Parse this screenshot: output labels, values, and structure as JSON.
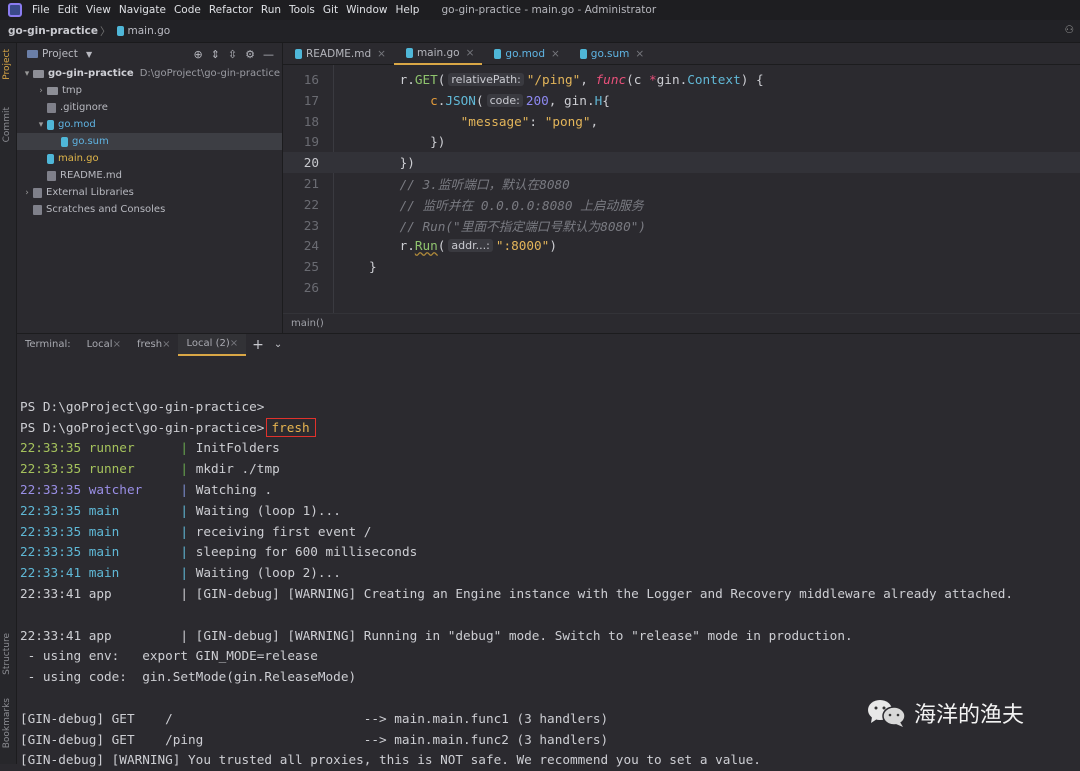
{
  "menu": [
    "File",
    "Edit",
    "View",
    "Navigate",
    "Code",
    "Refactor",
    "Run",
    "Tools",
    "Git",
    "Window",
    "Help"
  ],
  "window_title": "go-gin-practice - main.go - Administrator",
  "breadcrumb": {
    "project": "go-gin-practice",
    "file": "main.go"
  },
  "left_strip": {
    "project": "Project",
    "commit": "Commit",
    "structure": "Structure",
    "bookmarks": "Bookmarks"
  },
  "project_panel": {
    "title": "Project",
    "tree": [
      {
        "label": "go-gin-practice",
        "extra": "D:\\goProject\\go-gin-practice",
        "indent": 0,
        "arrow": "▾",
        "icon": "folder",
        "bold": true,
        "color": "#cfd0d6"
      },
      {
        "label": "tmp",
        "indent": 1,
        "arrow": "›",
        "icon": "folder",
        "color": "#b8b9c0"
      },
      {
        "label": ".gitignore",
        "indent": 1,
        "arrow": "",
        "icon": "file",
        "color": "#b8b9c0"
      },
      {
        "label": "go.mod",
        "indent": 1,
        "arrow": "▾",
        "icon": "go",
        "color": "#5fb4e3"
      },
      {
        "label": "go.sum",
        "indent": 2,
        "arrow": "",
        "icon": "go",
        "color": "#5fb4e3",
        "selected": true
      },
      {
        "label": "main.go",
        "indent": 1,
        "arrow": "",
        "icon": "go",
        "color": "#e0b64a"
      },
      {
        "label": "README.md",
        "indent": 1,
        "arrow": "",
        "icon": "md",
        "color": "#b8b9c0"
      },
      {
        "label": "External Libraries",
        "indent": 0,
        "arrow": "›",
        "icon": "lib",
        "color": "#b8b9c0"
      },
      {
        "label": "Scratches and Consoles",
        "indent": 0,
        "arrow": "",
        "icon": "scratch",
        "color": "#b8b9c0"
      }
    ]
  },
  "editor_tabs": [
    {
      "label": "README.md",
      "color": "#b5b6bd",
      "active": false
    },
    {
      "label": "main.go",
      "color": "#b5b6bd",
      "active": true
    },
    {
      "label": "go.mod",
      "color": "#5fb4e3",
      "active": false
    },
    {
      "label": "go.sum",
      "color": "#5fb4e3",
      "active": false
    }
  ],
  "code_lines": [
    {
      "n": "16",
      "indent": 4,
      "segs": [
        [
          "r",
          "#cdced3"
        ],
        [
          ".",
          "#cdced3"
        ],
        [
          "GET",
          "#8fc46e"
        ],
        [
          "(",
          "#cdced3"
        ],
        {
          "hint": "relativePath:"
        },
        [
          "\"/ping\"",
          "#e3b55a"
        ],
        [
          ", ",
          "#cdced3"
        ],
        [
          "func",
          "#e8507a",
          "i"
        ],
        [
          "(c ",
          "#cdced3"
        ],
        [
          "*",
          "#e8507a"
        ],
        [
          "gin.",
          "#cdced3"
        ],
        [
          "Context",
          "#61b8d6"
        ],
        [
          ") {",
          "#cdced3"
        ]
      ]
    },
    {
      "n": "17",
      "indent": 8,
      "segs": [
        [
          "c",
          "#e39b3a"
        ],
        [
          ".",
          "#cdced3"
        ],
        [
          "JSON",
          "#61b8d6"
        ],
        [
          "(",
          "#cdced3"
        ],
        {
          "hint": "code:"
        },
        [
          "200",
          "#8d88f0"
        ],
        [
          ", gin.",
          "#cdced3"
        ],
        [
          "H",
          "#61b8d6"
        ],
        [
          "{",
          "#cdced3"
        ]
      ]
    },
    {
      "n": "18",
      "indent": 12,
      "segs": [
        [
          "\"message\"",
          "#e3b55a"
        ],
        [
          ": ",
          "#cdced3"
        ],
        [
          "\"pong\"",
          "#e3b55a"
        ],
        [
          ",",
          "#cdced3"
        ]
      ]
    },
    {
      "n": "19",
      "indent": 8,
      "segs": [
        [
          "})",
          "#cdced3"
        ]
      ]
    },
    {
      "n": "20",
      "indent": 4,
      "segs": [
        [
          "})",
          "#cdced3"
        ]
      ],
      "current": true
    },
    {
      "n": "21",
      "indent": 4,
      "segs": [
        [
          "// 3.监听端口，默认在8080",
          "#7a7b82",
          "i"
        ]
      ]
    },
    {
      "n": "22",
      "indent": 4,
      "segs": [
        [
          "// 监听并在 0.0.0.0:8080 上启动服务",
          "#7a7b82",
          "i"
        ]
      ]
    },
    {
      "n": "23",
      "indent": 4,
      "segs": [
        [
          "// Run(\"里面不指定端口号默认为8080\")",
          "#7a7b82",
          "i"
        ]
      ]
    },
    {
      "n": "24",
      "indent": 4,
      "segs": [
        [
          "r.",
          "#cdced3"
        ],
        [
          "Run",
          "#8fc46e",
          "u"
        ],
        [
          "(",
          "#cdced3"
        ],
        {
          "hint": "addr...:"
        },
        [
          "\":8000\"",
          "#e3b55a"
        ],
        [
          ")",
          "#cdced3"
        ]
      ]
    },
    {
      "n": "25",
      "indent": 0,
      "segs": [
        [
          "}",
          "#cdced3"
        ]
      ]
    },
    {
      "n": "26",
      "indent": 0,
      "segs": []
    }
  ],
  "editor_breadcrumb": "main()",
  "terminal": {
    "label": "Terminal:",
    "tabs": [
      {
        "label": "Local",
        "active": false
      },
      {
        "label": "fresh",
        "active": false
      },
      {
        "label": "Local (2)",
        "active": true
      }
    ],
    "lines": [
      [],
      [
        [
          "PS D:\\goProject\\go-gin-practice>",
          "#cdced3"
        ]
      ],
      [
        [
          "PS D:\\goProject\\go-gin-practice>",
          "#cdced3"
        ],
        {
          "box": "fresh",
          "c": "#e6b450"
        }
      ],
      [
        [
          "22:33:35 runner      ",
          "#a5c25c"
        ],
        [
          "| ",
          "#6aa84f"
        ],
        [
          "InitFolders",
          "#cdced3"
        ]
      ],
      [
        [
          "22:33:35 runner      ",
          "#a5c25c"
        ],
        [
          "| ",
          "#6aa84f"
        ],
        [
          "mkdir ./tmp",
          "#cdced3"
        ]
      ],
      [
        [
          "22:33:35 watcher     ",
          "#9a8fe6"
        ],
        [
          "| ",
          "#7d8fd0"
        ],
        [
          "Watching .",
          "#cdced3"
        ]
      ],
      [
        [
          "22:33:35 main        ",
          "#5fb8d6"
        ],
        [
          "| ",
          "#5fb8d6"
        ],
        [
          "Waiting (loop 1)...",
          "#cdced3"
        ]
      ],
      [
        [
          "22:33:35 main        ",
          "#5fb8d6"
        ],
        [
          "| ",
          "#5fb8d6"
        ],
        [
          "receiving first event /",
          "#cdced3"
        ]
      ],
      [
        [
          "22:33:35 main        ",
          "#5fb8d6"
        ],
        [
          "| ",
          "#5fb8d6"
        ],
        [
          "sleeping for 600 milliseconds",
          "#cdced3"
        ]
      ],
      [
        [
          "22:33:41 main        ",
          "#5fb8d6"
        ],
        [
          "| ",
          "#5fb8d6"
        ],
        [
          "Waiting (loop 2)...",
          "#cdced3"
        ]
      ],
      [
        [
          "22:33:41 app         | [GIN-debug] [WARNING] Creating an Engine instance with the Logger and Recovery middleware already attached.",
          "#cdced3"
        ]
      ],
      [],
      [
        [
          "22:33:41 app         | [GIN-debug] [WARNING] Running in \"debug\" mode. Switch to \"release\" mode in production.",
          "#cdced3"
        ]
      ],
      [
        [
          " - using env:   export GIN_MODE=release",
          "#cdced3"
        ]
      ],
      [
        [
          " - using code:  gin.SetMode(gin.ReleaseMode)",
          "#cdced3"
        ]
      ],
      [],
      [
        [
          "[GIN-debug] GET    /                         --> main.main.func1 (3 handlers)",
          "#cdced3"
        ]
      ],
      [
        [
          "[GIN-debug] GET    /ping                     --> main.main.func2 (3 handlers)",
          "#cdced3"
        ]
      ],
      [
        [
          "[GIN-debug] [WARNING] You trusted all proxies, this is NOT safe. We recommend you to set a value.",
          "#cdced3"
        ]
      ]
    ]
  },
  "watermark": "海洋的渔夫"
}
